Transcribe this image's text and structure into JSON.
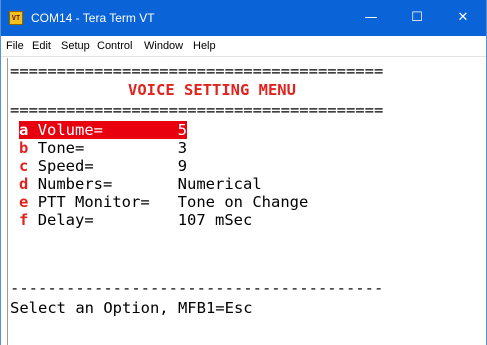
{
  "window": {
    "title": "COM14 - Tera Term VT",
    "icon_text": "VT",
    "controls": {
      "minimize": "—",
      "maximize": "☐",
      "close": "✕"
    }
  },
  "menubar": {
    "items": [
      "File",
      "Edit",
      "Setup",
      "Control",
      "Window",
      "Help"
    ]
  },
  "terminal": {
    "rule_double": "========================================",
    "heading": "VOICE SETTING MENU",
    "options": [
      {
        "key": "a",
        "label": "Volume=",
        "value": "5",
        "selected": true
      },
      {
        "key": "b",
        "label": "Tone=",
        "value": "3",
        "selected": false
      },
      {
        "key": "c",
        "label": "Speed=",
        "value": "9",
        "selected": false
      },
      {
        "key": "d",
        "label": "Numbers=",
        "value": "Numerical",
        "selected": false
      },
      {
        "key": "e",
        "label": "PTT Monitor=",
        "value": "Tone on Change",
        "selected": false
      },
      {
        "key": "f",
        "label": "Delay=",
        "value": "107 mSec",
        "selected": false
      }
    ],
    "rule_single": "----------------------------------------",
    "prompt": "Select an Option, MFB1=Esc"
  },
  "colors": {
    "titlebar": "#0a64d8",
    "heading": "#e0231e",
    "selection": "#e8000f"
  }
}
